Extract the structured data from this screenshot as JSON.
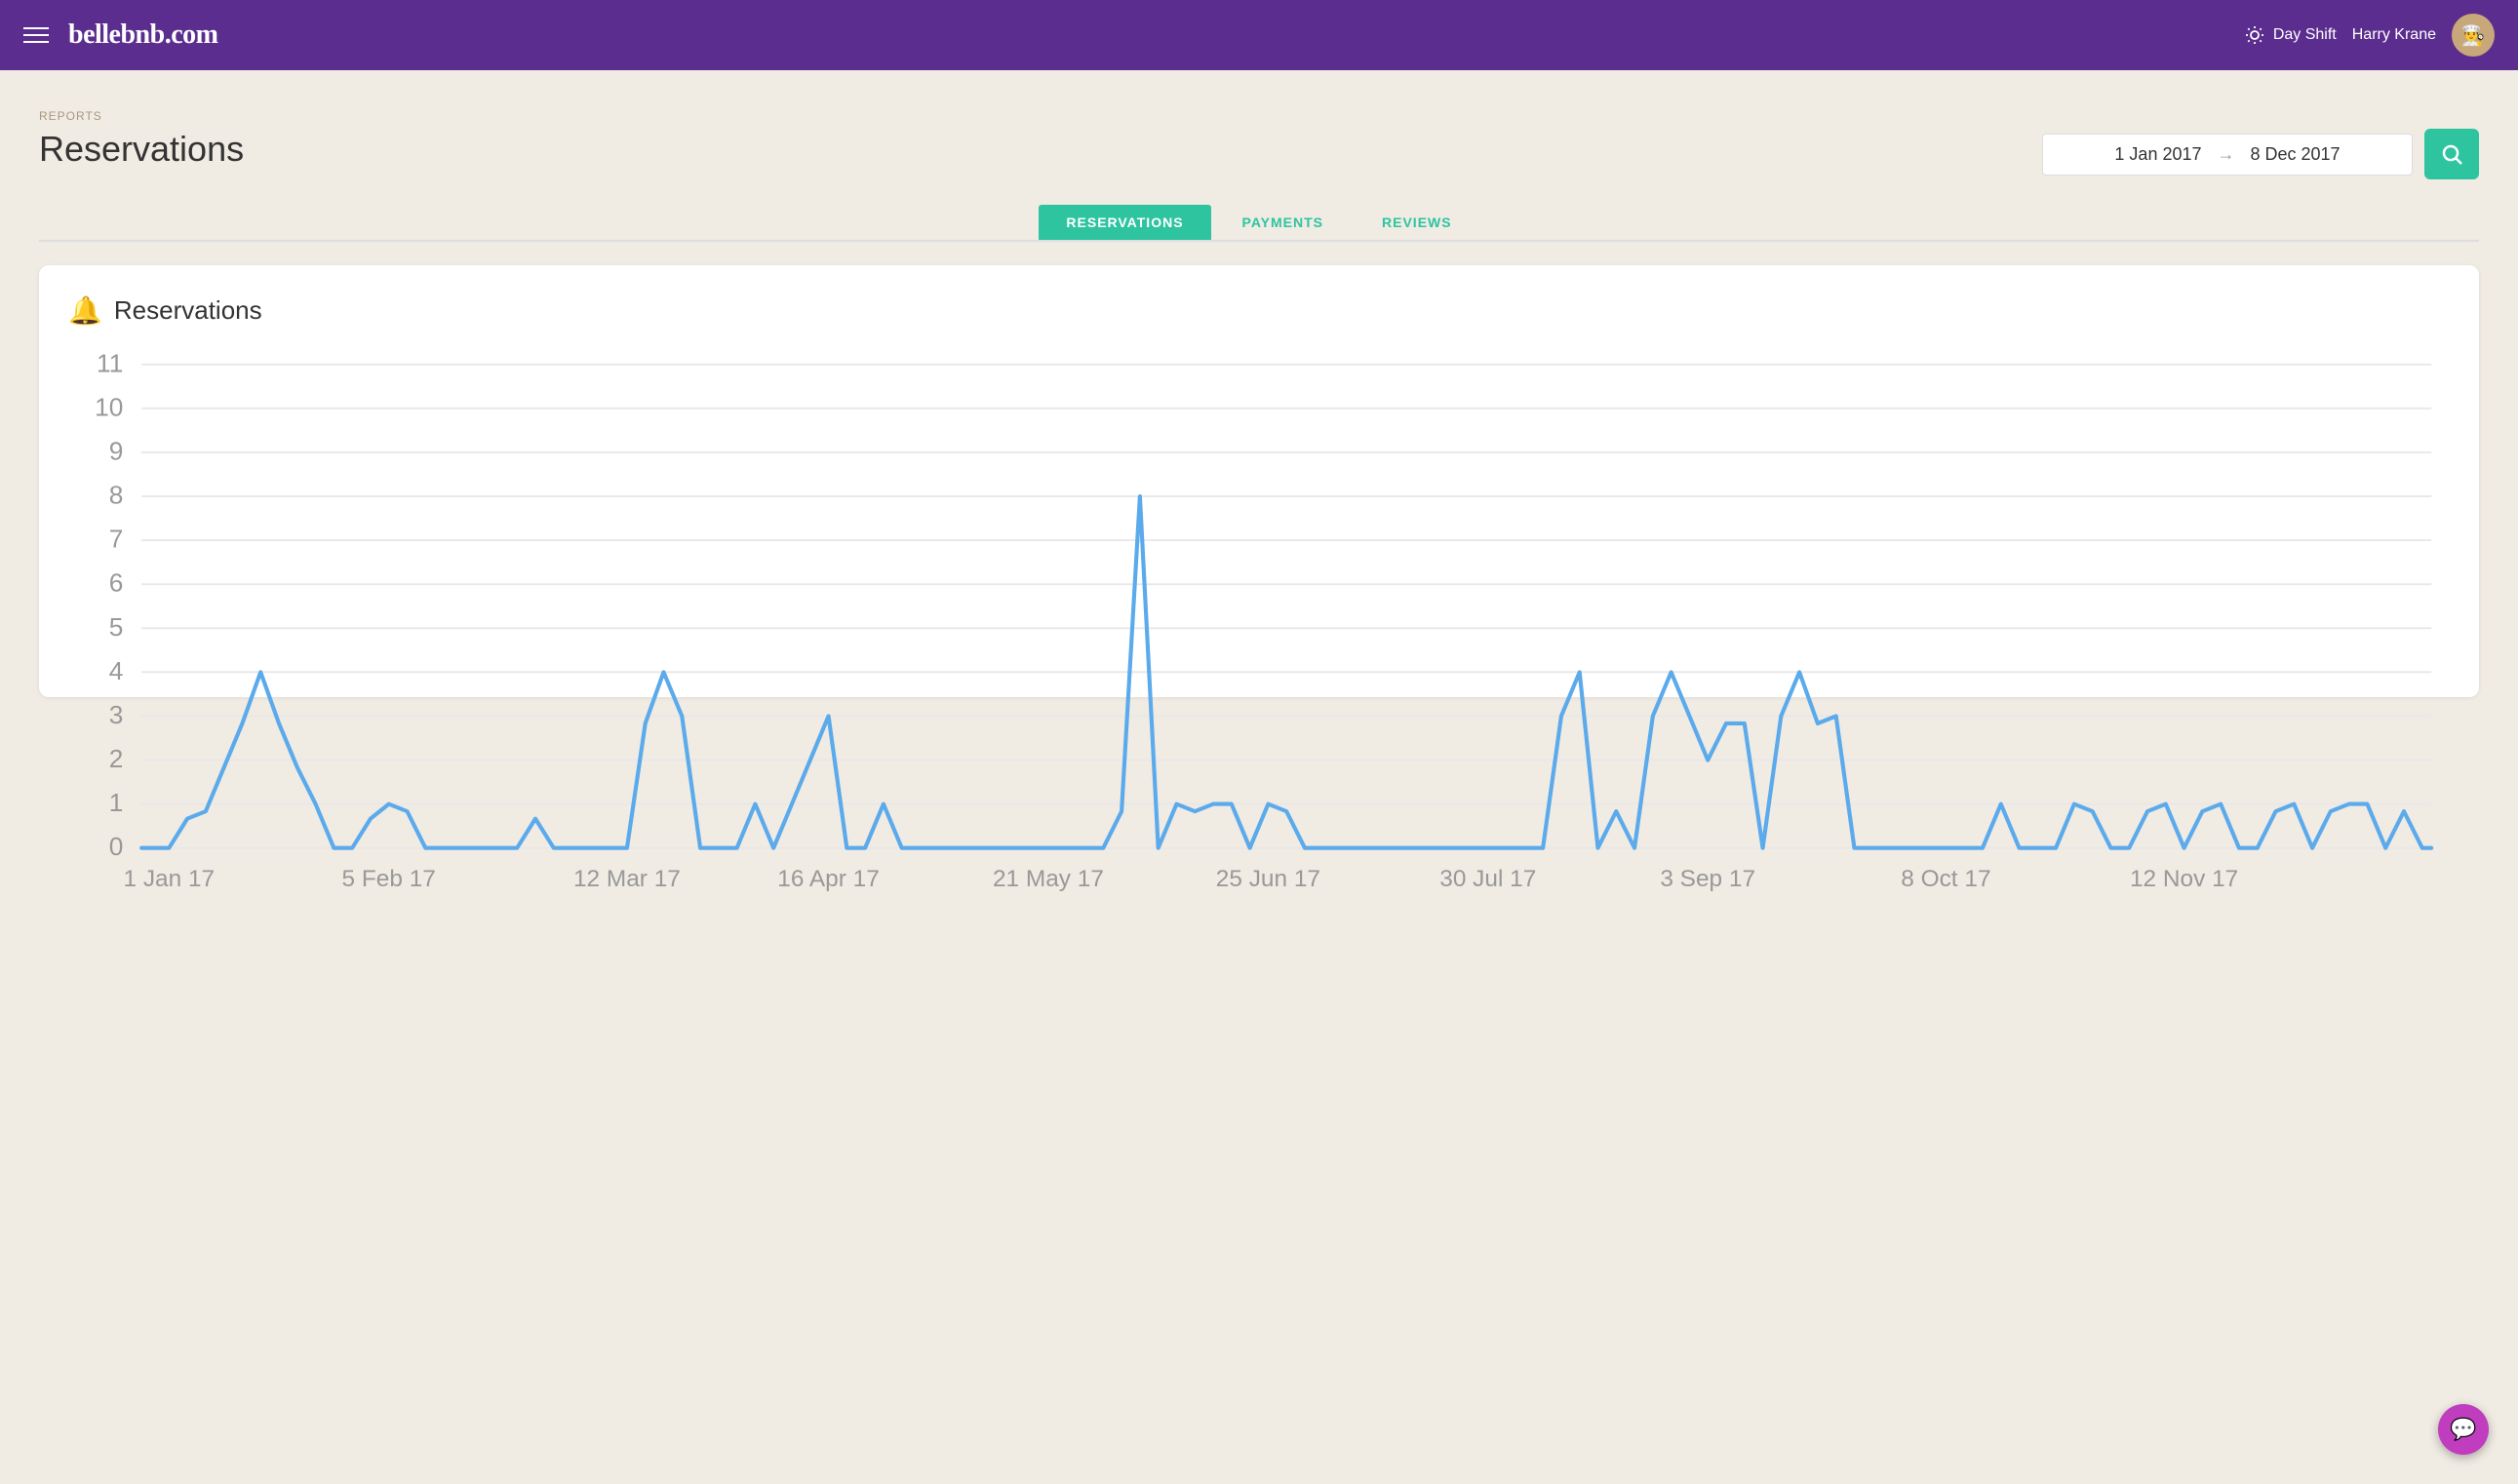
{
  "header": {
    "logo": "bellebnb.com",
    "mode": "Day Shift",
    "user_name": "Harry Krane",
    "avatar_emoji": "👨‍🍳"
  },
  "breadcrumb": "REPORTS",
  "page_title": "Reservations",
  "date_range": {
    "start": "1 Jan 2017",
    "end": "8 Dec 2017"
  },
  "tabs": [
    {
      "id": "reservations",
      "label": "RESERVATIONS",
      "active": true
    },
    {
      "id": "payments",
      "label": "PAYMENTS",
      "active": false
    },
    {
      "id": "reviews",
      "label": "REVIEWS",
      "active": false
    }
  ],
  "chart": {
    "title": "Reservations",
    "y_labels": [
      "0",
      "1",
      "2",
      "3",
      "4",
      "5",
      "6",
      "7",
      "8",
      "9",
      "10",
      "11"
    ],
    "x_labels": [
      "1 Jan 17",
      "5 Feb 17",
      "12 Mar 17",
      "16 Apr 17",
      "21 May 17",
      "25 Jun 17",
      "30 Jul 17",
      "3 Sep 17",
      "8 Oct 17",
      "12 Nov 17"
    ]
  },
  "search_button_label": "Search"
}
